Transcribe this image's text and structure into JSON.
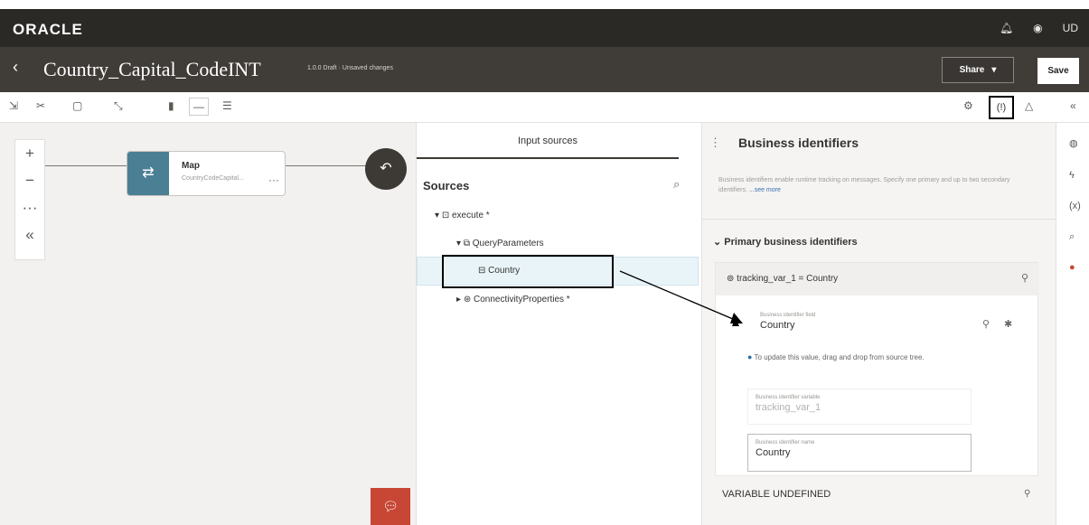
{
  "brand": {
    "logo": "ORACLE"
  },
  "topbar": {
    "icons": [
      "bell-icon",
      "help-icon"
    ],
    "user_initials": "UD"
  },
  "titlebar": {
    "back_icon": "‹",
    "title": "Country_Capital_CodeINT",
    "version_status": "1.0.0 Draft · Unsaved changes",
    "share_label": "Share",
    "save_label": "Save"
  },
  "toolbar": {
    "left_icons": [
      "import-icon",
      "cut-icon",
      "paste-icon",
      "collapse-icon",
      "vertical-layout-icon",
      "horizontal-layout-icon",
      "free-layout-icon"
    ],
    "right_icons": [
      "settings-icon",
      "business-identifiers-icon",
      "warning-icon",
      "collapse-rail-icon"
    ],
    "highlight_label": "(!)"
  },
  "canvas": {
    "zoom": {
      "in": "+",
      "out": "−",
      "more": "···",
      "collapse": "«"
    },
    "map_node": {
      "title": "Map",
      "subtitle": "CountryCodeCapital...",
      "more": "···"
    },
    "chat_icon": "chat-icon"
  },
  "sources": {
    "tab_label": "Input sources",
    "heading": "Sources",
    "tree": [
      {
        "label": "execute *",
        "level": 1,
        "expanded": true
      },
      {
        "label": "QueryParameters",
        "level": 2,
        "expanded": true
      },
      {
        "label": "Country",
        "level": 3,
        "selected": true
      },
      {
        "label": "ConnectivityProperties *",
        "level": 2,
        "expanded": false
      }
    ]
  },
  "business": {
    "title": "Business identifiers",
    "description": "Business identifiers enable runtime tracking on messages. Specify one primary and up to two secondary identifiers.",
    "see_more": "...see more",
    "primary_heading": "Primary business identifiers",
    "identifier_summary": "tracking_var_1 = Country",
    "field_label": "Business identifier field",
    "field_value": "Country",
    "info_text": "To update this value, drag and drop from source tree.",
    "variable_label": "Business identifier variable",
    "variable_value": "tracking_var_1",
    "name_label": "Business identifier name",
    "name_value": "Country",
    "undefined_label": "VARIABLE UNDEFINED"
  },
  "right_rail": {
    "icons": [
      "globe-icon",
      "lightning-icon",
      "variable-icon",
      "search-icon",
      "integration-icon"
    ]
  },
  "colors": {
    "topbar": "#2b2926",
    "titlebar": "#403c38",
    "map_node": "#4a7f94",
    "chat": "#c74634",
    "accent_blue": "#2a6ea7"
  }
}
